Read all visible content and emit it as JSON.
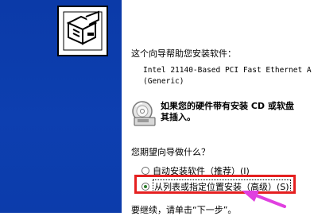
{
  "wizard": {
    "intro": "这个向导帮助您安装软件：",
    "device_line1": "Intel 21140-Based PCI Fast Ethernet A",
    "device_line2": "(Generic)",
    "disk_prompt_line1": "如果您的硬件带有安装 CD 或软盘",
    "disk_prompt_line2": "其插入。",
    "question": "您期望向导做什么？",
    "options": [
      {
        "label": "自动安装软件（推荐）(I)",
        "selected": false
      },
      {
        "label": "从列表或指定位置安装（高级）(S)",
        "selected": true
      }
    ],
    "next_hint": "要继续，请单击“下一步”。"
  },
  "icons": {
    "banner": "hardware-install-icon",
    "cd": "cd-disk-icon",
    "annotation": "pointer-arrow-icon"
  },
  "colors": {
    "banner_blue": "#0c3cab",
    "highlight_red": "#e52020",
    "arrow_magenta": "#e040e0"
  }
}
